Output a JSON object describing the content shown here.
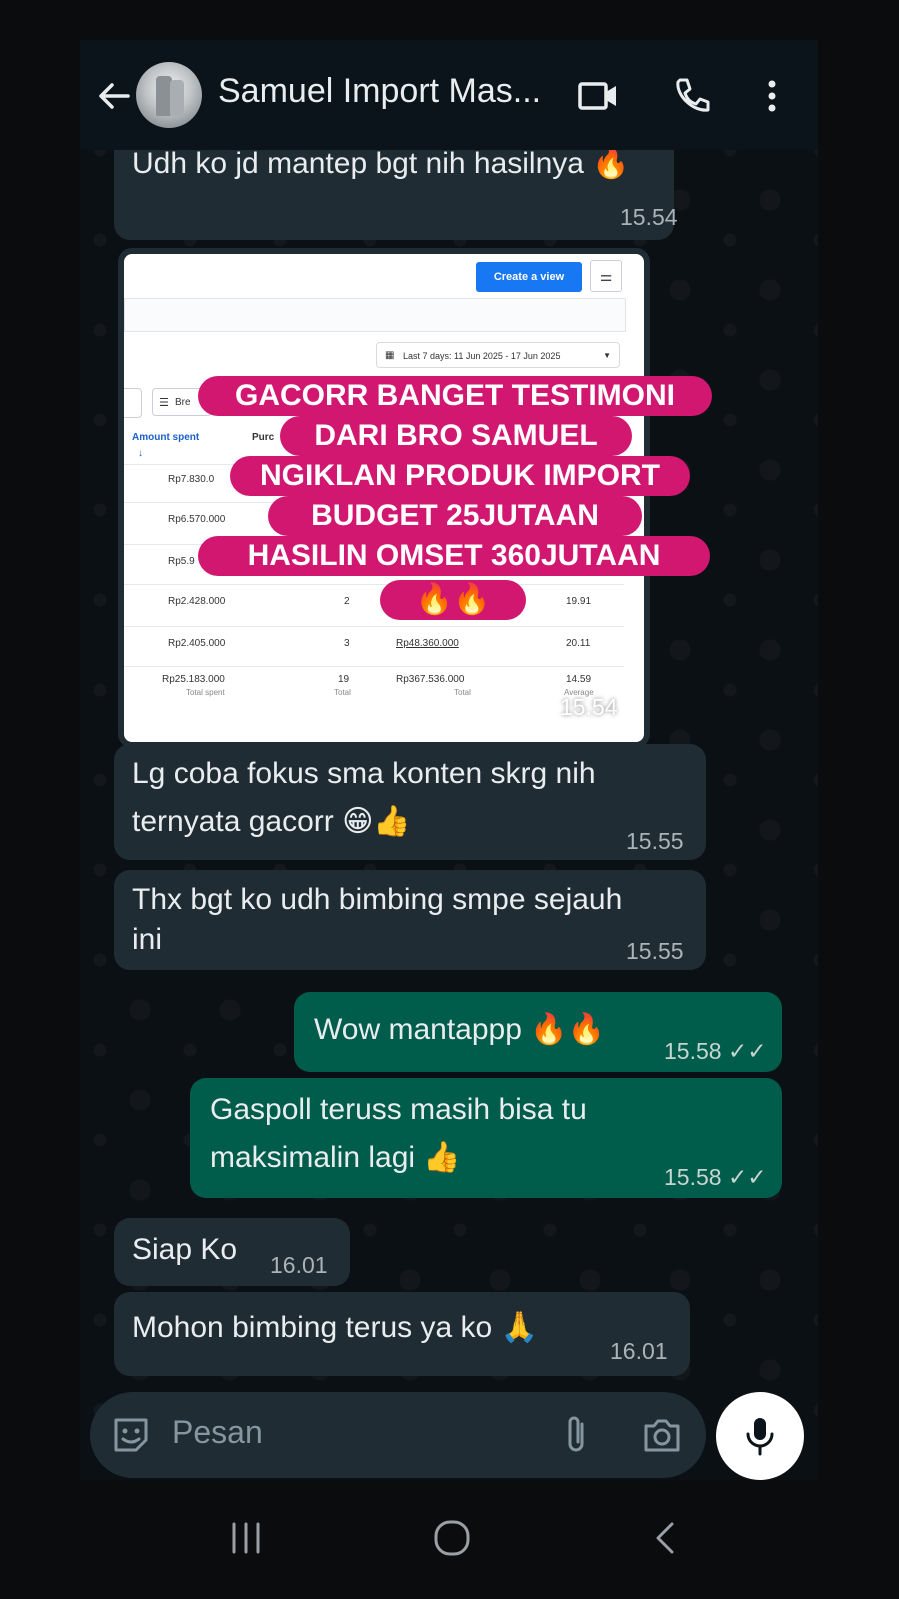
{
  "header": {
    "contact_name": "Samuel Import Mas...",
    "back_icon": "arrow-left-icon",
    "video_icon": "video-call-icon",
    "phone_icon": "phone-icon",
    "menu_icon": "more-vert-icon"
  },
  "messages": [
    {
      "direction": "in",
      "text": "Udh ko jd mantep bgt nih hasilnya",
      "emoji": "🔥",
      "time": "15.54"
    },
    {
      "direction": "in",
      "type": "image",
      "time": "15.54"
    },
    {
      "direction": "in",
      "line1": "Lg coba fokus sma konten skrg nih",
      "line2": "ternyata gacorr",
      "emoji": "😁👍",
      "time": "15.55"
    },
    {
      "direction": "in",
      "line1": "Thx bgt ko udh bimbing smpe sejauh",
      "line2": "ini",
      "time": "15.55"
    },
    {
      "direction": "out",
      "text": "Wow mantappp",
      "emoji": "🔥🔥",
      "time": "15.58",
      "status": "✓✓"
    },
    {
      "direction": "out",
      "line1": "Gaspoll teruss masih bisa tu",
      "line2": "maksimalin lagi",
      "emoji": "👍",
      "time": "15.58",
      "status": "✓✓"
    },
    {
      "direction": "in",
      "text": "Siap Ko",
      "time": "16.01"
    },
    {
      "direction": "in",
      "text": "Mohon bimbing terus ya ko",
      "emoji": "🙏",
      "time": "16.01"
    }
  ],
  "screenshot": {
    "create_view": "Create a view",
    "date_range": "Last 7 days: 11 Jun 2025 - 17 Jun 2025",
    "breakdown": "Bre",
    "col_amount": "Amount spent",
    "col_purchases": "Purc",
    "rows": [
      {
        "amount": "Rp7.830.0",
        "purchases": "",
        "value": "",
        "roas": ""
      },
      {
        "amount": "Rp6.570.000",
        "purchases": "",
        "value": "",
        "roas": ""
      },
      {
        "amount": "Rp5.9",
        "purchases": "",
        "value": "",
        "roas": ""
      },
      {
        "amount": "Rp2.428.000",
        "purchases": "2",
        "value": "",
        "roas": "19.91"
      },
      {
        "amount": "Rp2.405.000",
        "purchases": "3",
        "value": "Rp48.360.000",
        "roas": "20.11"
      }
    ],
    "totals": {
      "amount": "Rp25.183.000",
      "amount_label": "Total spent",
      "purchases": "19",
      "purchases_label": "Total",
      "value": "Rp367.536.000",
      "value_label": "Total",
      "roas": "14.59",
      "roas_label": "Average"
    }
  },
  "overlay": {
    "lines": [
      "GACORR BANGET TESTIMONI",
      "DARI BRO SAMUEL",
      "NGIKLAN PRODUK IMPORT",
      "BUDGET 25JUTAAN",
      "HASILIN OMSET 360JUTAAN"
    ],
    "fire": "🔥🔥",
    "color": "#d1176f"
  },
  "input": {
    "placeholder": "Pesan",
    "emoji_icon": "sticker-icon",
    "attach_icon": "paperclip-icon",
    "camera_icon": "camera-icon",
    "mic_icon": "mic-icon"
  },
  "colors": {
    "incoming": "#202c33",
    "outgoing": "#005c4b",
    "background": "#0b141a"
  }
}
